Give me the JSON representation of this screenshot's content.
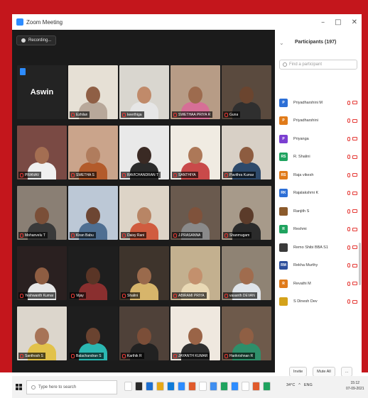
{
  "window": {
    "title": "Zoom Meeting",
    "controls": [
      "–",
      "□",
      "✕"
    ]
  },
  "recording": {
    "label": "Recording..."
  },
  "self_tile": {
    "name": "Aswin"
  },
  "video_tiles": [
    {
      "name": "",
      "bg": "#232323",
      "skin": "#b07a58",
      "shirt": "#cfcfcf"
    },
    {
      "name": "Ezhilan",
      "bg": "#e6e0d5",
      "skin": "#8f5f45",
      "shirt": "#b8a89a"
    },
    {
      "name": "keerthiga",
      "bg": "#d9d6cf",
      "skin": "#c08a6a",
      "shirt": "#e6e6e6"
    },
    {
      "name": "SWETHAA PRIYA R",
      "bg": "#b79c86",
      "skin": "#9d6b4e",
      "shirt": "#d66f96"
    },
    {
      "name": "Guna",
      "bg": "#5a4a3e",
      "skin": "#6b452f",
      "shirt": "#2f2f2f"
    },
    {
      "name": "PRANAV",
      "bg": "#7a4a44",
      "skin": "#a46e52",
      "shirt": "#f0f0f0"
    },
    {
      "name": "SWETHA S",
      "bg": "#caa48b",
      "skin": "#b07c5d",
      "shirt": "#b35b2b"
    },
    {
      "name": "RAVICHANDRAN T",
      "bg": "#e9e9e9",
      "skin": "#3a2a24",
      "shirt": "#2b2b2b"
    },
    {
      "name": "SANTHIYA",
      "bg": "#f0ebe2",
      "skin": "#ad7858",
      "shirt": "#c94a4a"
    },
    {
      "name": "Pavithra Kumar",
      "bg": "#d8d0c6",
      "skin": "#8d5c40",
      "shirt": "#2e4a6b"
    },
    {
      "name": "Mohanvelu T",
      "bg": "#8a7f74",
      "skin": "#7a4f38",
      "shirt": "#3a3a3a"
    },
    {
      "name": "Kiran Babu",
      "bg": "#bcc8d6",
      "skin": "#6d4633",
      "shirt": "#4f6f92"
    },
    {
      "name": "Daisy Rani",
      "bg": "#ddd4c7",
      "skin": "#b88565",
      "shirt": "#d05c3f"
    },
    {
      "name": "J.PRASANNA",
      "bg": "#6a5a4e",
      "skin": "#7f523b",
      "shirt": "#8a8a8a"
    },
    {
      "name": "Shanmugam",
      "bg": "#a79a8a",
      "skin": "#5b3b2a",
      "shirt": "#2b2b2b"
    },
    {
      "name": "Yeshwanth Kumar",
      "bg": "#2a2020",
      "skin": "#8e5d42",
      "shirt": "#e6e6e6"
    },
    {
      "name": "Vijay",
      "bg": "#1e1e1e",
      "skin": "#5a3526",
      "shirt": "#8a2f2f"
    },
    {
      "name": "Shalini",
      "bg": "#3e342c",
      "skin": "#9a6a4c",
      "shirt": "#d7b56b"
    },
    {
      "name": "ABIRAMI PRIYA",
      "bg": "#c3b08f",
      "skin": "#c3906d",
      "shirt": "#e9d9b5"
    },
    {
      "name": "vasanth DEVAN",
      "bg": "#8f8374",
      "skin": "#a06c4e",
      "shirt": "#dfe4ea"
    },
    {
      "name": "Santhosh S",
      "bg": "#dcd6cc",
      "skin": "#a77457",
      "shirt": "#e2c24a"
    },
    {
      "name": "Balachandran S",
      "bg": "#1e1e1e",
      "skin": "#6a4330",
      "shirt": "#2bb7b1"
    },
    {
      "name": "Karthik R",
      "bg": "#4f4139",
      "skin": "#7b4e38",
      "shirt": "#222222"
    },
    {
      "name": "JAYANTH KUMAR",
      "bg": "#efe8df",
      "skin": "#9a6447",
      "shirt": "#2f2f2f"
    },
    {
      "name": "Harikrishnan R",
      "bg": "#6e5a4b",
      "skin": "#8f5f44",
      "shirt": "#2e8f6a"
    }
  ],
  "panel": {
    "title": "Participants (197)",
    "search_placeholder": "Find a participant",
    "participants": [
      {
        "initials": "P",
        "name": "Priyadharshini M",
        "color": "#2d6fd6"
      },
      {
        "initials": "P",
        "name": "Priyadharshini",
        "color": "#e07b1a"
      },
      {
        "initials": "P",
        "name": "Priyanga",
        "color": "#7b3fd1"
      },
      {
        "initials": "RS",
        "name": "R. Shalini",
        "color": "#1fa35f"
      },
      {
        "initials": "RS",
        "name": "Raja vikesh",
        "color": "#e07b1a"
      },
      {
        "initials": "RK",
        "name": "Rajalakshmi K",
        "color": "#2d6fd6"
      },
      {
        "initials": "",
        "name": "Ranjith S",
        "color": "#8b5a2b"
      },
      {
        "initials": "R",
        "name": "Reshmi",
        "color": "#1fa35f"
      },
      {
        "initials": "",
        "name": "Remo Shibi BBA S1",
        "color": "#3a3a3a"
      },
      {
        "initials": "RM",
        "name": "Rekha Murthy",
        "color": "#2d4f9c"
      },
      {
        "initials": "R",
        "name": "Revathi M",
        "color": "#e07b1a"
      },
      {
        "initials": "",
        "name": "S Dinesh Dev",
        "color": "#d4a21a"
      }
    ],
    "invite_label": "Invite",
    "mute_all_label": "Mute All",
    "more_label": "..."
  },
  "taskbar": {
    "search_placeholder": "Type here to search",
    "app_colors": [
      "#ffffff",
      "#2b2b2b",
      "#1d6fd1",
      "#e6a817",
      "#0f7bd8",
      "#2d8cff",
      "#e05a2b",
      "#ffffff",
      "#3f8ef0",
      "#1fa35f",
      "#2d8cff",
      "#ffffff",
      "#e05a2b",
      "#1fa35f"
    ],
    "weather": "34°C",
    "lang": "ENG",
    "time": "15:12",
    "date": "07-09-2021"
  }
}
